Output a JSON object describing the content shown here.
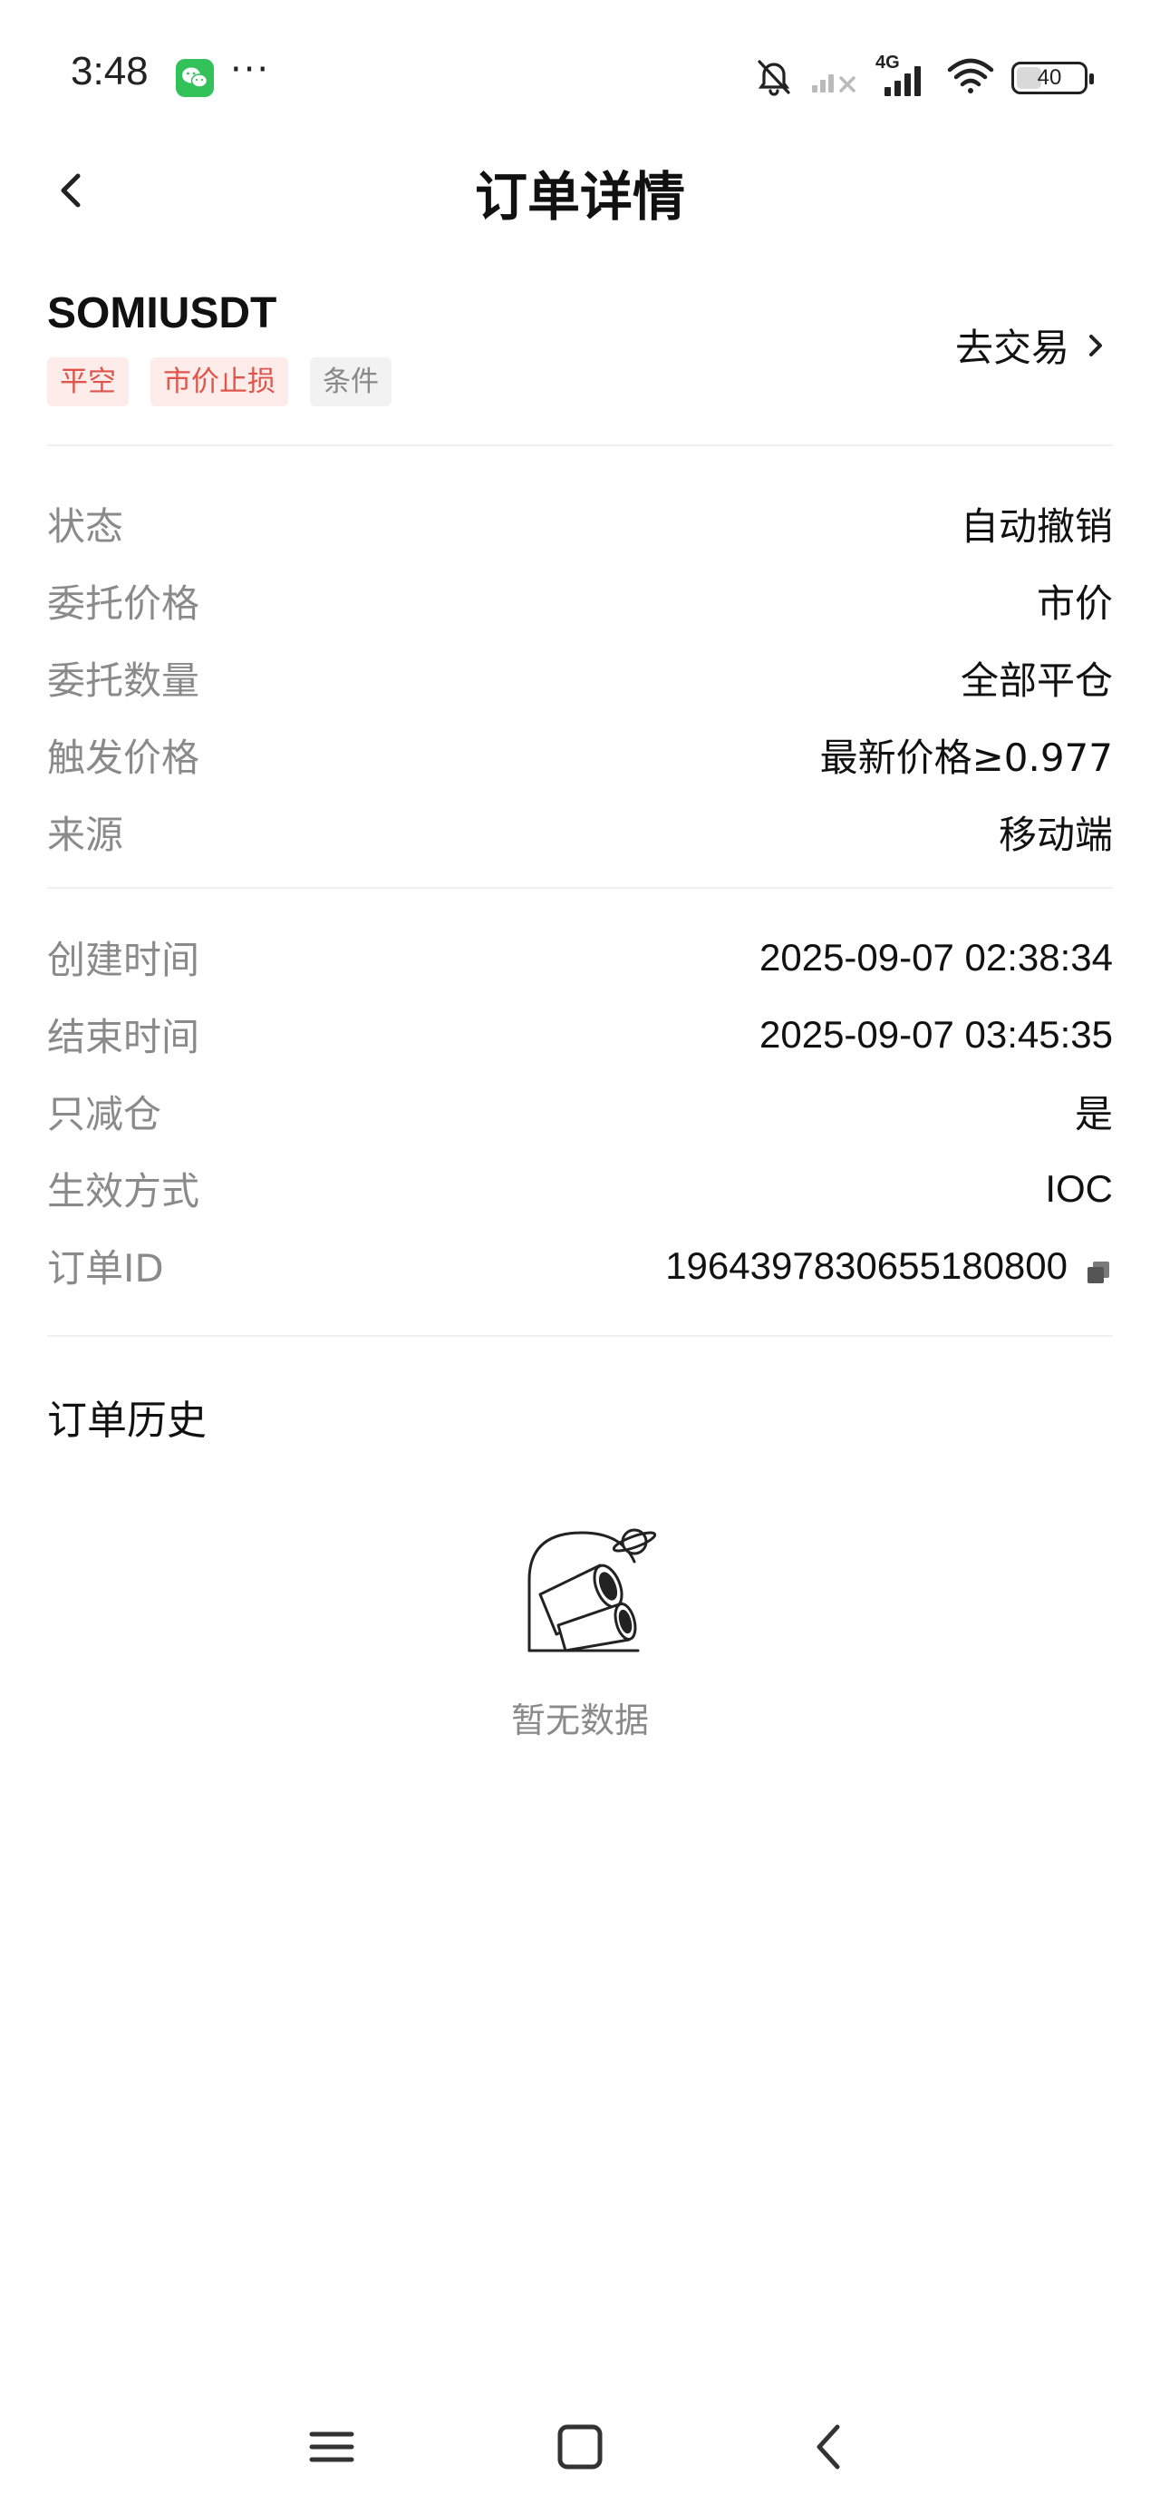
{
  "status_bar": {
    "time": "3:48",
    "network_label": "4G",
    "battery": "40",
    "icons": [
      "wechat-icon",
      "more-dots-icon",
      "bell-muted-icon",
      "signal-icon",
      "signal-4g-icon",
      "wifi-icon",
      "battery-icon"
    ]
  },
  "header": {
    "title": "订单详情",
    "back_icon": "chevron-left-icon"
  },
  "order": {
    "symbol": "SOMIUSDT",
    "tags": [
      {
        "label": "平空",
        "color": "#e0554b"
      },
      {
        "label": "市价止损",
        "color": "#e0554b"
      },
      {
        "label": "条件",
        "color": "#888888"
      }
    ],
    "go_trade_label": "去交易"
  },
  "details": [
    {
      "label": "状态",
      "value": "自动撤销"
    },
    {
      "label": "委托价格",
      "value": "市价"
    },
    {
      "label": "委托数量",
      "value": "全部平仓"
    },
    {
      "label": "触发价格",
      "value": "最新价格≥0.977"
    },
    {
      "label": "来源",
      "value": "移动端"
    }
  ],
  "details2": [
    {
      "label": "创建时间",
      "value": "2025-09-07 02:38:34"
    },
    {
      "label": "结束时间",
      "value": "2025-09-07 03:45:35"
    },
    {
      "label": "只减仓",
      "value": "是"
    },
    {
      "label": "生效方式",
      "value": "IOC"
    },
    {
      "label": "订单ID",
      "value": "1964397830655180800"
    }
  ],
  "history": {
    "title": "订单历史",
    "empty_text": "暂无数据"
  },
  "nav_bar": {
    "icons": [
      "menu-icon",
      "home-square-icon",
      "back-triangle-icon"
    ]
  }
}
